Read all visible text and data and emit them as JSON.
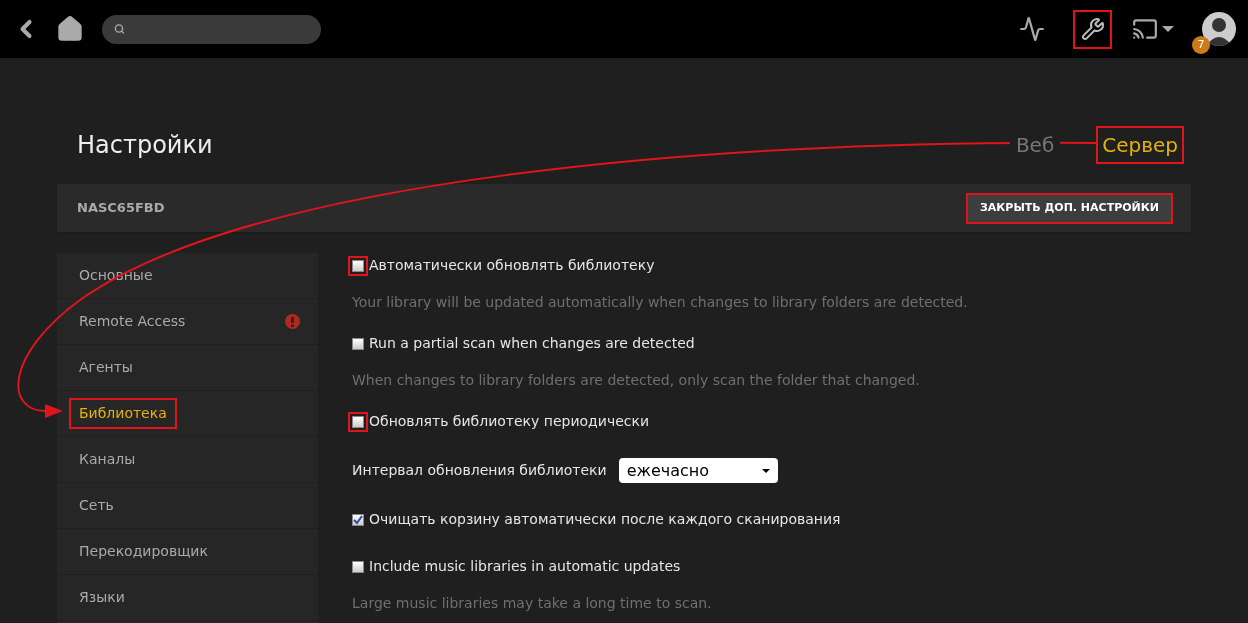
{
  "top_bar": {
    "tools_highlighted": true,
    "notification_count": "7"
  },
  "title": "Настройки",
  "tabs": [
    {
      "label": "Веб",
      "selected": false,
      "highlighted": false
    },
    {
      "label": "Сервер",
      "selected": true,
      "highlighted": true
    }
  ],
  "server_bar": {
    "name": "NASC65FBD",
    "button": {
      "label": "ЗАКРЫТЬ ДОП. НАСТРОЙКИ",
      "highlighted": true
    }
  },
  "sidebar": {
    "items": [
      {
        "label": "Основные",
        "selected": false,
        "warning": false,
        "highlighted": false
      },
      {
        "label": "Remote Access",
        "selected": false,
        "warning": true,
        "highlighted": false
      },
      {
        "label": "Агенты",
        "selected": false,
        "warning": false,
        "highlighted": false
      },
      {
        "label": "Библиотека",
        "selected": true,
        "warning": false,
        "highlighted": true
      },
      {
        "label": "Каналы",
        "selected": false,
        "warning": false,
        "highlighted": false
      },
      {
        "label": "Сеть",
        "selected": false,
        "warning": false,
        "highlighted": false
      },
      {
        "label": "Перекодировщик",
        "selected": false,
        "warning": false,
        "highlighted": false
      },
      {
        "label": "Языки",
        "selected": false,
        "warning": false,
        "highlighted": false
      }
    ]
  },
  "settings": [
    {
      "kind": "checkbox",
      "label": "Автоматически обновлять библиотеку",
      "checked": false,
      "highlighted": true,
      "description": "Your library will be updated automatically when changes to library folders are detected."
    },
    {
      "kind": "checkbox",
      "label": "Run a partial scan when changes are detected",
      "checked": false,
      "highlighted": false,
      "description": "When changes to library folders are detected, only scan the folder that changed."
    },
    {
      "kind": "checkbox",
      "label": "Обновлять библиотеку периодически",
      "checked": false,
      "highlighted": true
    },
    {
      "kind": "select",
      "label": "Интервал обновления библиотеки",
      "value": "ежечасно"
    },
    {
      "kind": "checkbox",
      "label": "Очищать корзину автоматически после каждого сканирования",
      "checked": true,
      "highlighted": false
    },
    {
      "kind": "checkbox",
      "label": "Include music libraries in automatic updates",
      "checked": false,
      "highlighted": false,
      "description": "Large music libraries may take a long time to scan."
    }
  ],
  "annotation_arrow": true
}
